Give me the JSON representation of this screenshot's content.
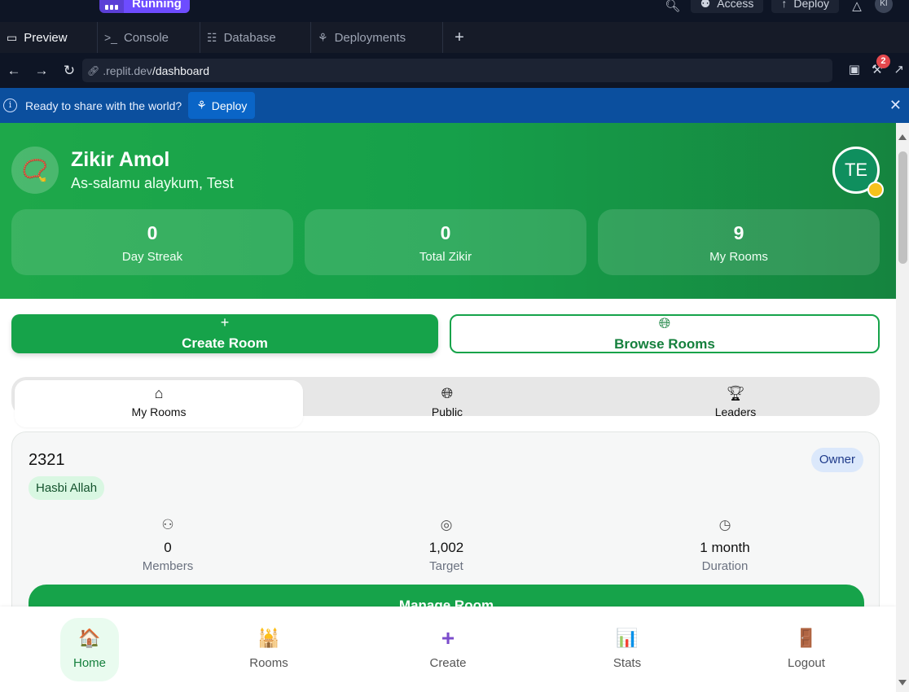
{
  "ide": {
    "run_status": "Running",
    "top_buttons": [
      {
        "icon": "user-icon",
        "label": "Access"
      },
      {
        "icon": "upload-icon",
        "label": "Deploy"
      }
    ],
    "avatar_initials": "KI",
    "tabs": [
      {
        "icon": "monitor-icon",
        "label": "Preview"
      },
      {
        "icon": "terminal-icon",
        "label": "Console"
      },
      {
        "icon": "database-icon",
        "label": "Database"
      },
      {
        "icon": "deploy-tree-icon",
        "label": "Deployments"
      }
    ],
    "url_prefix": ".replit.dev",
    "url_path": "/dashboard",
    "notification_count": "2",
    "banner_text": "Ready to share with the world?",
    "banner_button": "Deploy"
  },
  "app": {
    "title": "Zikir Amol",
    "greeting": "As-salamu alaykum, Test",
    "avatar_initials": "TE",
    "stats": [
      {
        "value": "0",
        "label": "Day Streak"
      },
      {
        "value": "0",
        "label": "Total Zikir"
      },
      {
        "value": "9",
        "label": "My Rooms"
      }
    ],
    "actions": {
      "create": "Create Room",
      "browse": "Browse Rooms"
    },
    "segments": [
      {
        "icon": "home-icon",
        "label": "My Rooms"
      },
      {
        "icon": "globe-icon",
        "label": "Public"
      },
      {
        "icon": "trophy-icon",
        "label": "Leaders"
      }
    ],
    "room": {
      "name": "2321",
      "role": "Owner",
      "tag": "Hasbi Allah",
      "metrics": [
        {
          "icon": "users-icon",
          "value": "0",
          "label": "Members"
        },
        {
          "icon": "target-icon",
          "value": "1,002",
          "label": "Target"
        },
        {
          "icon": "clock-icon",
          "value": "1 month",
          "label": "Duration"
        }
      ],
      "manage": "Manage Room"
    },
    "bottom_nav": [
      {
        "icon": "house-icon",
        "label": "Home"
      },
      {
        "icon": "mosque-icon",
        "label": "Rooms"
      },
      {
        "icon": "plus-icon",
        "label": "Create"
      },
      {
        "icon": "bar-chart-icon",
        "label": "Stats"
      },
      {
        "icon": "door-icon",
        "label": "Logout"
      }
    ]
  }
}
